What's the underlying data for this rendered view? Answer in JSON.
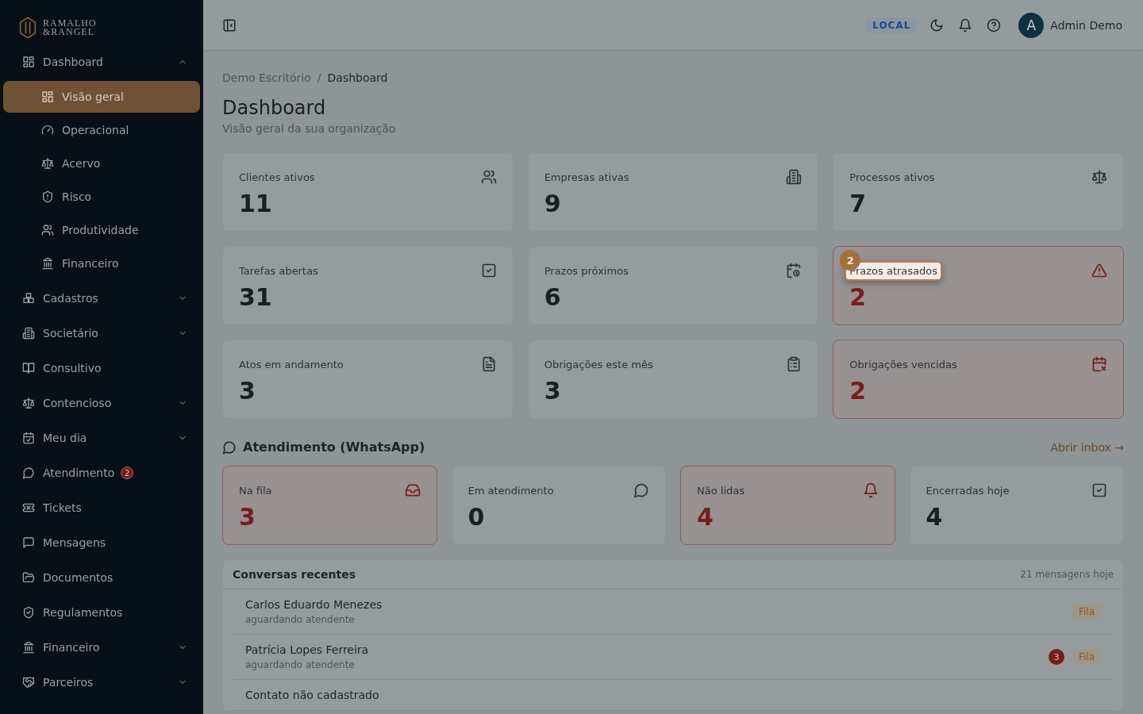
{
  "sidebar": {
    "logo": {
      "line1": "RAMALHO",
      "line2": "&RANGEL"
    },
    "items": [
      {
        "label": "Dashboard",
        "kind": "group",
        "expanded": true,
        "children": [
          {
            "label": "Visão geral",
            "selected": true
          },
          {
            "label": "Operacional",
            "selected": false
          },
          {
            "label": "Acervo",
            "selected": false
          },
          {
            "label": "Risco",
            "selected": false
          },
          {
            "label": "Produtividade",
            "selected": false
          },
          {
            "label": "Financeiro",
            "selected": false
          }
        ]
      },
      {
        "label": "Cadastros",
        "kind": "group",
        "expanded": false
      },
      {
        "label": "Societário",
        "kind": "group",
        "expanded": false
      },
      {
        "label": "Consultivo",
        "kind": "link"
      },
      {
        "label": "Contencioso",
        "kind": "group",
        "expanded": false
      },
      {
        "label": "Meu dia",
        "kind": "group",
        "expanded": false
      },
      {
        "label": "Atendimento",
        "kind": "link",
        "badge": "2"
      },
      {
        "label": "Tickets",
        "kind": "link"
      },
      {
        "label": "Mensagens",
        "kind": "link"
      },
      {
        "label": "Documentos",
        "kind": "link"
      },
      {
        "label": "Regulamentos",
        "kind": "link"
      },
      {
        "label": "Financeiro",
        "kind": "group",
        "expanded": false
      },
      {
        "label": "Parceiros",
        "kind": "group",
        "expanded": false
      }
    ]
  },
  "header": {
    "env_badge": "LOCAL",
    "user": {
      "initial": "A",
      "name": "Admin Demo"
    }
  },
  "breadcrumb": [
    "Demo Escritório",
    "Dashboard"
  ],
  "breadcrumb_separator": "/",
  "title": "Dashboard",
  "subtitle": "Visão geral da sua organização",
  "tour": {
    "step": "2"
  },
  "stats": [
    {
      "label": "Clientes ativos",
      "value": "11",
      "alert": false,
      "highlighted": false
    },
    {
      "label": "Empresas ativas",
      "value": "9",
      "alert": false,
      "highlighted": false
    },
    {
      "label": "Processos ativos",
      "value": "7",
      "alert": false,
      "highlighted": false
    },
    {
      "label": "Tarefas abertas",
      "value": "31",
      "alert": false,
      "highlighted": false
    },
    {
      "label": "Prazos próximos",
      "value": "6",
      "alert": false,
      "highlighted": false
    },
    {
      "label": "Prazos atrasados",
      "value": "2",
      "alert": true,
      "highlighted": true
    },
    {
      "label": "Atos em andamento",
      "value": "3",
      "alert": false,
      "highlighted": false
    },
    {
      "label": "Obrigações este mês",
      "value": "3",
      "alert": false,
      "highlighted": false
    },
    {
      "label": "Obrigações vencidas",
      "value": "2",
      "alert": true,
      "highlighted": false
    }
  ],
  "whatsapp": {
    "title": "Atendimento (WhatsApp)",
    "link": "Abrir inbox →",
    "stats": [
      {
        "label": "Na fila",
        "value": "3",
        "alert": true
      },
      {
        "label": "Em atendimento",
        "value": "0",
        "alert": false
      },
      {
        "label": "Não lidas",
        "value": "4",
        "alert": true
      },
      {
        "label": "Encerradas hoje",
        "value": "4",
        "alert": false
      }
    ]
  },
  "conversations": {
    "title": "Conversas recentes",
    "count": "21 mensagens hoje",
    "rows": [
      {
        "name": "Carlos Eduardo Menezes",
        "status": "aguardando atendente",
        "tag": "Fila"
      },
      {
        "name": "Patrícia Lopes Ferreira",
        "status": "aguardando atendente",
        "unread": "3",
        "tag": "Fila"
      },
      {
        "name": "Contato não cadastrado"
      }
    ]
  }
}
